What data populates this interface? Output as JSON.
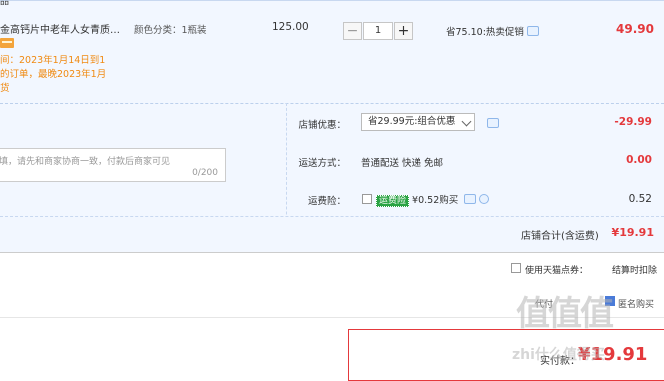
{
  "order": {
    "top_title": "品",
    "product_name": "金高钙片中老年人女青质…",
    "color_category": "颜色分类：1瓶装",
    "delivery_line1": "间：2023年1月14日到1",
    "delivery_line2": "的订单，最晚2023年1月",
    "delivery_line3": "货",
    "unit_price": "125.00",
    "qty": "1",
    "qty_minus": "−",
    "qty_plus": "+",
    "promo_text": "省75.10:热卖促销",
    "item_total": "49.90"
  },
  "shop": {
    "discount_label": "店铺优惠：",
    "discount_select": "省29.99元:组合优惠",
    "discount_value": "-29.99",
    "memo_placeholder": "填，请先和商家协商一致，付款后商家可见",
    "memo_count": "0/200",
    "shipping_label": "运送方式：",
    "shipping_value": "普通配送 快递 免邮",
    "shipping_cost": "0.00",
    "insurance_label": "运费险：",
    "insurance_tag": "运费险",
    "insurance_text": "¥0.52购买",
    "insurance_cost": "0.52",
    "total_label": "店铺合计(含运费)",
    "total_value": "¥19.91"
  },
  "coupon": {
    "use_tmall_points": "使用天猫点券：",
    "settle_deduct": "结算时扣除",
    "partial_left": "代付",
    "partial_right": "匿名购买"
  },
  "final": {
    "paid_label": "实付款：",
    "paid_value": "¥19.91"
  },
  "watermark": {
    "site": "zhi什么值得买",
    "logo": "值"
  },
  "colors": {
    "accent_red": "#e4393c",
    "panel_blue": "#f2f7ff",
    "orange": "#f08a12"
  }
}
